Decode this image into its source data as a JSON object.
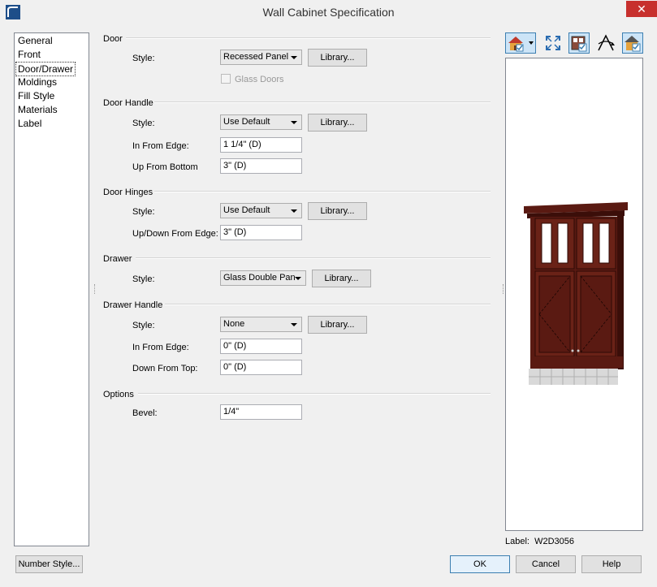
{
  "window": {
    "title": "Wall Cabinet Specification",
    "close_glyph": "✕"
  },
  "nav": {
    "items": [
      "General",
      "Front",
      "Door/Drawer",
      "Moldings",
      "Fill Style",
      "Materials",
      "Label"
    ],
    "selected_index": 2
  },
  "door": {
    "section": "Door",
    "style_label": "Style:",
    "style_value": "Recessed Panel",
    "library_label": "Library...",
    "glass_label": "Glass Doors",
    "glass_checked": false
  },
  "door_handle": {
    "section": "Door Handle",
    "style_label": "Style:",
    "style_value": "Use Default",
    "library_label": "Library...",
    "in_from_edge_label": "In From Edge:",
    "in_from_edge_value": "1 1/4\" (D)",
    "up_from_bottom_label": "Up From Bottom",
    "up_from_bottom_value": "3\" (D)"
  },
  "door_hinges": {
    "section": "Door Hinges",
    "style_label": "Style:",
    "style_value": "Use Default",
    "library_label": "Library...",
    "updown_label": "Up/Down From Edge:",
    "updown_value": "3\" (D)"
  },
  "drawer": {
    "section": "Drawer",
    "style_label": "Style:",
    "style_value": "Glass Double Pan",
    "library_label": "Library..."
  },
  "drawer_handle": {
    "section": "Drawer Handle",
    "style_label": "Style:",
    "style_value": "None",
    "library_label": "Library...",
    "in_from_edge_label": "In From Edge:",
    "in_from_edge_value": "0\" (D)",
    "down_from_top_label": "Down From Top:",
    "down_from_top_value": "0\" (D)"
  },
  "options": {
    "section": "Options",
    "bevel_label": "Bevel:",
    "bevel_value": "1/4\""
  },
  "preview": {
    "label_caption": "Label:",
    "label_value": "W2D3056"
  },
  "footer": {
    "number_style": "Number Style...",
    "ok": "OK",
    "cancel": "Cancel",
    "help": "Help"
  },
  "colors": {
    "cabinet_wood": "#5a1a12",
    "cabinet_dark": "#3b0e09",
    "tile": "#d9d9d9",
    "accent": "#3c7fb1"
  }
}
